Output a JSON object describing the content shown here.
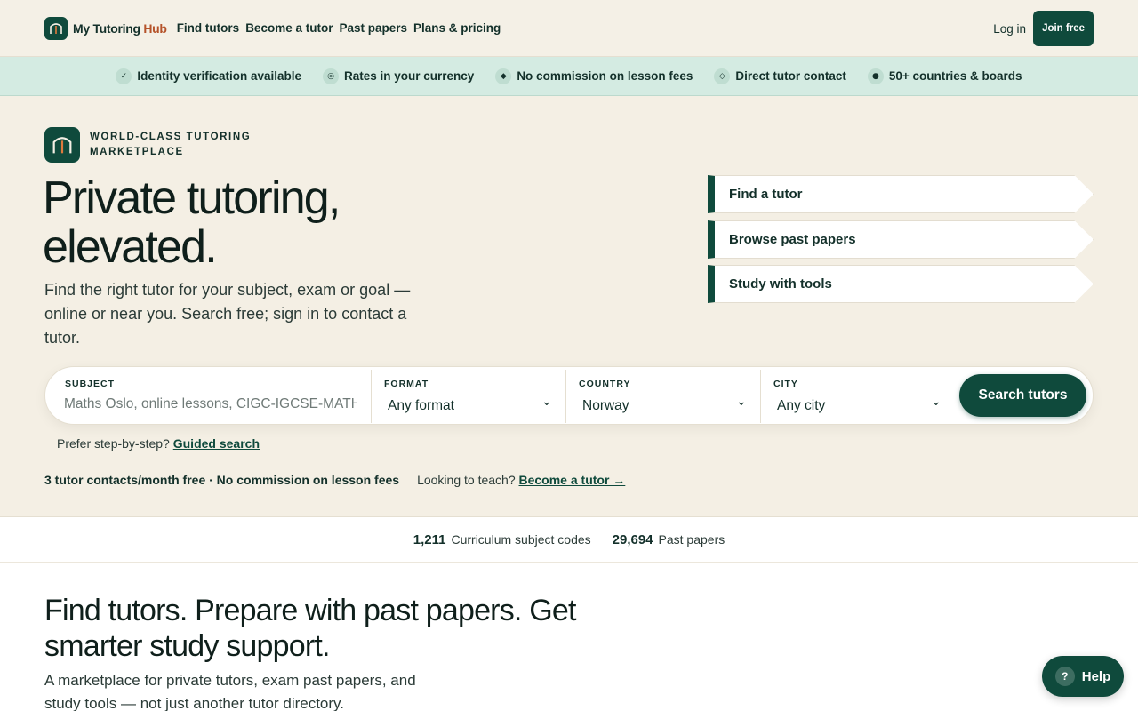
{
  "brand": {
    "name_a": "My Tutoring ",
    "name_b": "Hub",
    "accent": "#0f4a3c",
    "logo_icon": "house-arch-icon"
  },
  "nav": {
    "links": [
      "Find tutors",
      "Become a tutor",
      "Past papers",
      "Plans & pricing"
    ],
    "login": "Log in",
    "join": "Join free"
  },
  "trust": [
    {
      "icon": "check-icon",
      "glyph": "✓",
      "label": "Identity verification available"
    },
    {
      "icon": "currency-icon",
      "glyph": "◎",
      "label": "Rates in your currency"
    },
    {
      "icon": "diamond-icon",
      "glyph": "◆",
      "label": "No commission on lesson fees"
    },
    {
      "icon": "diamond-outline-icon",
      "glyph": "◇",
      "label": "Direct tutor contact"
    },
    {
      "icon": "dot-icon",
      "glyph": "●",
      "label": "50+ countries & boards"
    }
  ],
  "hero": {
    "eyebrow": "WORLD-CLASS TUTORING MARKETPLACE",
    "title": "Private tutoring, elevated.",
    "subtitle": "Find the right tutor for your subject, exam or goal — online or near you. Search free; sign in to contact a tutor.",
    "quick_links": [
      "Find a tutor",
      "Browse past papers",
      "Study with tools"
    ]
  },
  "search": {
    "subject_label": "SUBJECT",
    "subject_placeholder": "Maths Oslo, online lessons, CIGC-IGCSE-MATH",
    "format_label": "FORMAT",
    "format_value": "Any format",
    "country_label": "COUNTRY",
    "country_value": "Norway",
    "city_label": "CITY",
    "city_value": "Any city",
    "button": "Search tutors"
  },
  "guided": {
    "text": "Prefer step-by-step?",
    "link": "Guided search"
  },
  "meta": {
    "strong": "3 tutor contacts/month free · No commission on lesson fees",
    "teach_text": "Looking to teach?",
    "teach_link": "Become a tutor →"
  },
  "stats": [
    {
      "num": "1,211",
      "label": "Curriculum subject codes"
    },
    {
      "num": "29,694",
      "label": "Past papers"
    }
  ],
  "section": {
    "title": "Find tutors. Prepare with past papers. Get smarter study support.",
    "subtitle": "A marketplace for private tutors, exam past papers, and study tools — not just another tutor directory."
  },
  "help": {
    "label": "Help",
    "glyph": "?"
  }
}
